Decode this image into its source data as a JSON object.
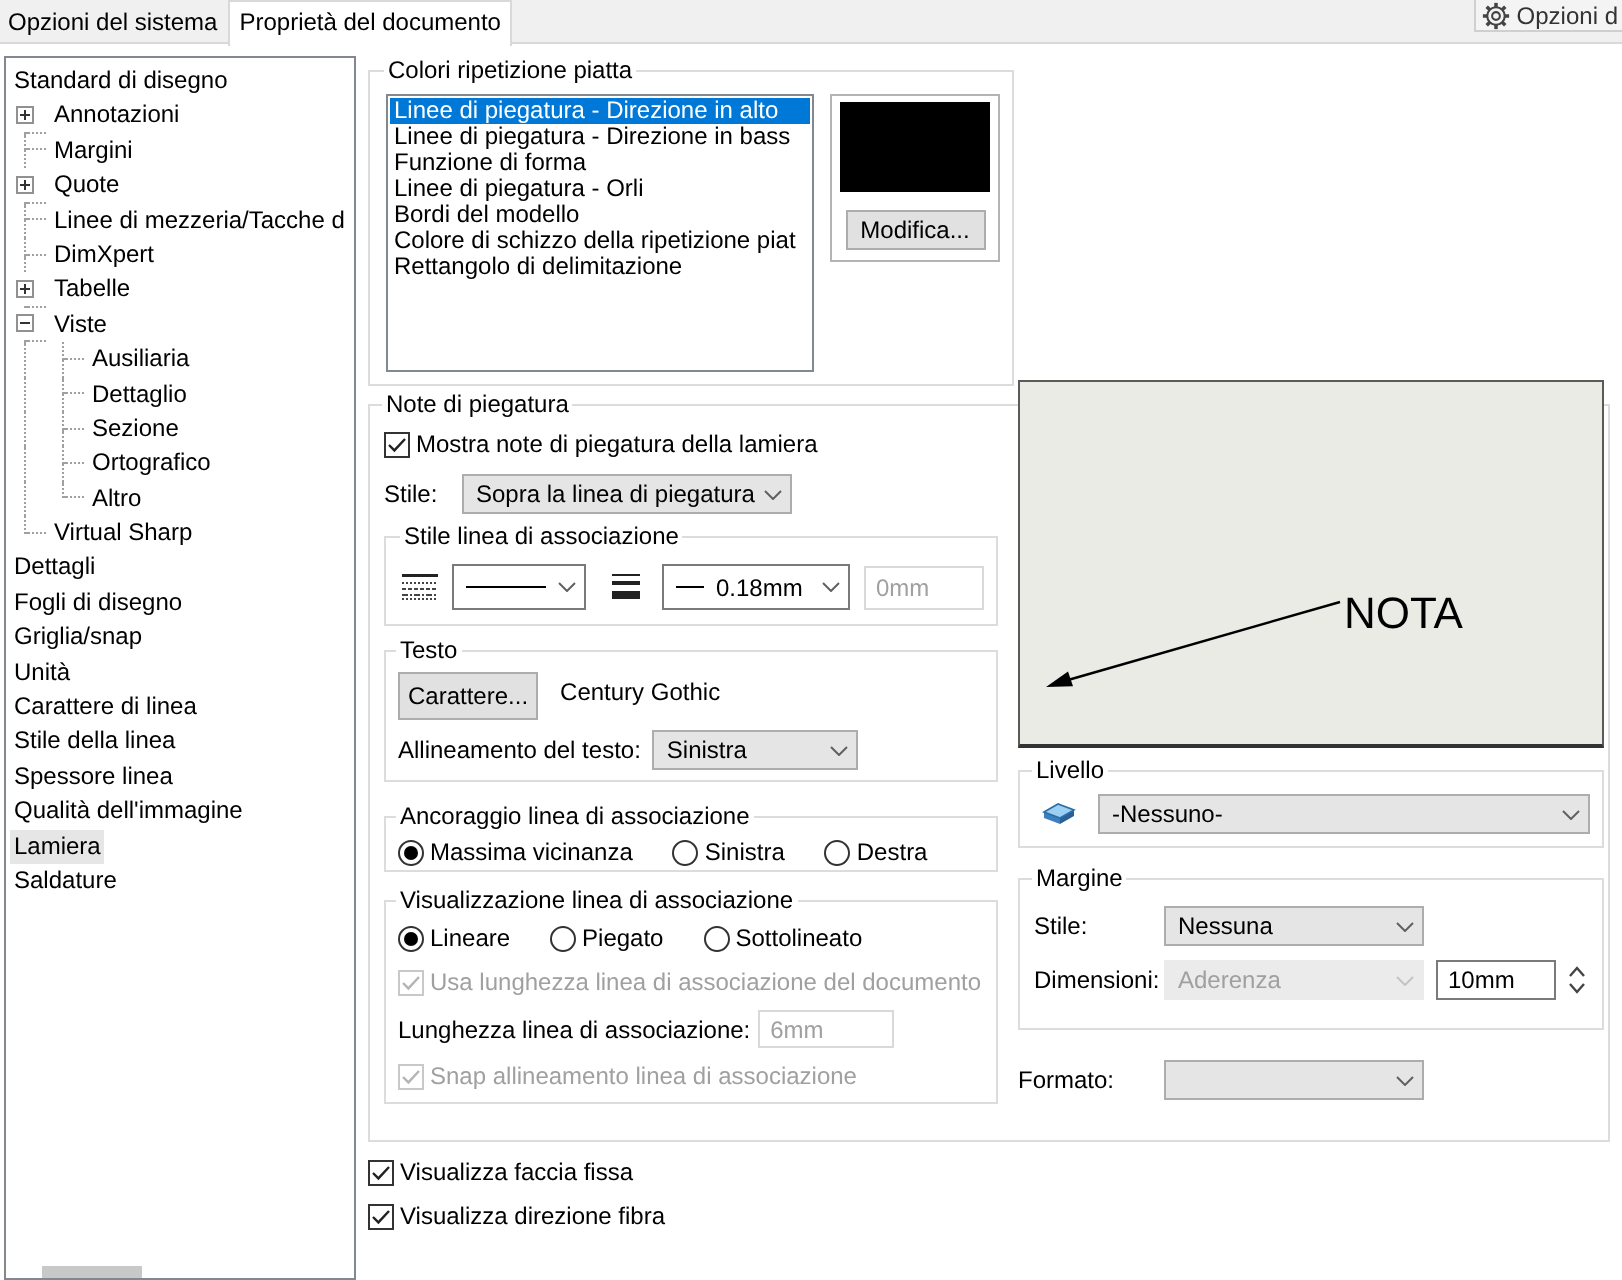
{
  "tabs": [
    {
      "label": "Opzioni del sistema",
      "selected": false
    },
    {
      "label": "Proprietà del documento",
      "selected": true
    }
  ],
  "options_button": {
    "label": "Opzioni d"
  },
  "tree": {
    "items": [
      {
        "label": "Standard di disegno",
        "selected": false,
        "children": [
          {
            "label": "Annotazioni",
            "selected": false,
            "expanded": false
          },
          {
            "label": "Margini",
            "selected": false
          },
          {
            "label": "Quote",
            "selected": false,
            "expanded": false
          },
          {
            "label": "Linee di mezzeria/Tacche d",
            "selected": false
          },
          {
            "label": "DimXpert",
            "selected": false
          },
          {
            "label": "Tabelle",
            "selected": false,
            "expanded": false
          },
          {
            "label": "Viste",
            "selected": false,
            "expanded": true,
            "children": [
              {
                "label": "Ausiliaria",
                "selected": false
              },
              {
                "label": "Dettaglio",
                "selected": false
              },
              {
                "label": "Sezione",
                "selected": false
              },
              {
                "label": "Ortografico",
                "selected": false
              },
              {
                "label": "Altro",
                "selected": false
              }
            ]
          },
          {
            "label": "Virtual Sharp",
            "selected": false
          }
        ]
      },
      {
        "label": "Dettagli",
        "selected": false
      },
      {
        "label": "Fogli di disegno",
        "selected": false
      },
      {
        "label": "Griglia/snap",
        "selected": false
      },
      {
        "label": "Unità",
        "selected": false
      },
      {
        "label": "Carattere di linea",
        "selected": false
      },
      {
        "label": "Stile della linea",
        "selected": false
      },
      {
        "label": "Spessore linea",
        "selected": false
      },
      {
        "label": "Qualità dell'immagine",
        "selected": false
      },
      {
        "label": "Lamiera",
        "selected": true
      },
      {
        "label": "Saldature",
        "selected": false
      }
    ]
  },
  "flat_pattern_colors": {
    "title": "Colori ripetizione piatta",
    "items": [
      {
        "label": "Linee di piegatura - Direzione in alto",
        "selected": true
      },
      {
        "label": "Linee di piegatura - Direzione in bass",
        "selected": false
      },
      {
        "label": "Funzione di forma",
        "selected": false
      },
      {
        "label": "Linee di piegatura - Orli",
        "selected": false
      },
      {
        "label": "Bordi del modello",
        "selected": false
      },
      {
        "label": "Colore di schizzo della ripetizione piat",
        "selected": false
      },
      {
        "label": "Rettangolo di delimitazione",
        "selected": false
      }
    ],
    "swatch": {
      "color": "#000000"
    },
    "button": "Modifica..."
  },
  "bend_notes": {
    "title": "Note di piegatura",
    "show_notes": {
      "label": "Mostra note di piegatura della lamiera",
      "checked": true
    },
    "style": {
      "label": "Stile:",
      "value": "Sopra la linea di piegatura"
    },
    "leader_style": {
      "title": "Stile linea di associazione",
      "weight": "0.18mm",
      "offset": {
        "value": "0mm",
        "disabled": true
      }
    },
    "text": {
      "title": "Testo",
      "font_button": "Carattere...",
      "font_name": "Century Gothic",
      "alignment": {
        "label": "Allineamento del testo:",
        "value": "Sinistra"
      }
    },
    "leader_anchor": {
      "title": "Ancoraggio linea di associazione",
      "options": [
        {
          "label": "Massima vicinanza",
          "selected": true
        },
        {
          "label": "Sinistra",
          "selected": false
        },
        {
          "label": "Destra",
          "selected": false
        }
      ]
    },
    "leader_display": {
      "title": "Visualizzazione linea di associazione",
      "options": [
        {
          "label": "Lineare",
          "selected": true
        },
        {
          "label": "Piegato",
          "selected": false
        },
        {
          "label": "Sottolineato",
          "selected": false
        }
      ],
      "use_document_length": {
        "label": "Usa lunghezza linea di associazione del documento",
        "checked": true,
        "disabled": true
      },
      "length": {
        "label": "Lunghezza linea di associazione:",
        "value": "6mm",
        "disabled": true
      },
      "snap_alignment": {
        "label": "Snap allineamento linea di associazione",
        "checked": true,
        "disabled": true
      }
    },
    "preview": {
      "note_text": "NOTA"
    },
    "layer": {
      "title": "Livello",
      "value": "-Nessuno-"
    },
    "border": {
      "title": "Margine",
      "style": {
        "label": "Stile:",
        "value": "Nessuna"
      },
      "size": {
        "label": "Dimensioni:",
        "value": "Aderenza",
        "disabled": true
      },
      "size_field": {
        "value": "10mm"
      }
    },
    "format": {
      "label": "Formato:"
    }
  },
  "display_options": [
    {
      "label": "Visualizza faccia fissa",
      "checked": true
    },
    {
      "label": "Visualizza direzione fibra",
      "checked": true
    }
  ]
}
